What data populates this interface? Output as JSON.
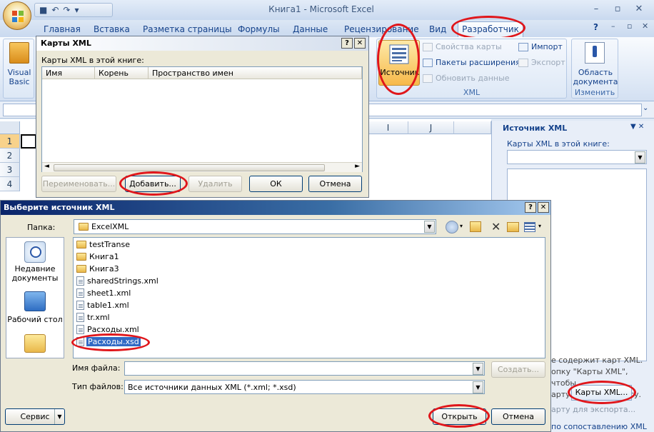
{
  "excel": {
    "title": "Книга1 - Microsoft Excel",
    "window_buttons": [
      "–",
      "▫",
      "✕"
    ],
    "ribbon_win_buttons": [
      "?",
      "–",
      "▫",
      "✕"
    ],
    "tabs": [
      "Главная",
      "Вставка",
      "Разметка страницы",
      "Формулы",
      "Данные",
      "Рецензирование",
      "Вид",
      "Разработчик"
    ],
    "ribbon": {
      "code_group": {
        "visual_basic": [
          "Visual",
          "Basic"
        ]
      },
      "xml_group": {
        "label": "XML",
        "source_btn": "Источник",
        "map_props": "Свойства карты",
        "expansion_packs": "Пакеты расширения",
        "refresh_data": "Обновить данные",
        "import": "Импорт",
        "export": "Экспорт"
      },
      "modify_group": {
        "label": "Изменить",
        "doc_area": [
          "Область",
          "документа"
        ]
      }
    },
    "sheet": {
      "col_headers": [
        "I",
        "J"
      ],
      "row_headers": [
        "1",
        "2",
        "3",
        "4"
      ]
    }
  },
  "xml_pane": {
    "title": "Источник XML",
    "close": "▼ ✕",
    "maps_label": "Карты XML в этой книге:",
    "cut_text": [
      "е содержит карт XML.",
      "опку \"Карты XML\", чтобы",
      "арту XML в эту книгу."
    ],
    "maps_button": "Карты XML...",
    "export_text": "арту для экспорта...",
    "bottom_text": "по сопоставлению XML"
  },
  "maps_dialog": {
    "title": "Карты XML",
    "help": "?",
    "close": "✕",
    "list_label": "Карты XML в этой книге:",
    "columns": [
      "Имя",
      "Корень",
      "Пространство имен"
    ],
    "buttons": {
      "rename": "Переименовать...",
      "add": "Добавить...",
      "delete": "Удалить",
      "ok": "ОК",
      "cancel": "Отмена"
    }
  },
  "file_dialog": {
    "title": "Выберите источник XML",
    "help": "?",
    "close": "✕",
    "folder_label": "Папка:",
    "folder_value": "ExcelXML",
    "places": [
      {
        "label": [
          "Недавние",
          "документы"
        ]
      },
      {
        "label": [
          "Рабочий стол"
        ]
      }
    ],
    "files": [
      {
        "name": "testTranse",
        "kind": "folder"
      },
      {
        "name": "Книга1",
        "kind": "folder"
      },
      {
        "name": "Книга3",
        "kind": "folder"
      },
      {
        "name": "sharedStrings.xml",
        "kind": "file"
      },
      {
        "name": "sheet1.xml",
        "kind": "file"
      },
      {
        "name": "table1.xml",
        "kind": "file"
      },
      {
        "name": "tr.xml",
        "kind": "file"
      },
      {
        "name": "Расходы.xml",
        "kind": "file"
      },
      {
        "name": "Расходы.xsd",
        "kind": "file",
        "selected": true
      }
    ],
    "filename_label": "Имя файла:",
    "filename_value": "",
    "filetype_label": "Тип файлов:",
    "filetype_value": "Все источники данных XML (*.xml; *.xsd)",
    "create_btn": "Создать...",
    "tools_btn": "Сервис",
    "open_btn": "Открыть",
    "cancel_btn": "Отмена"
  }
}
